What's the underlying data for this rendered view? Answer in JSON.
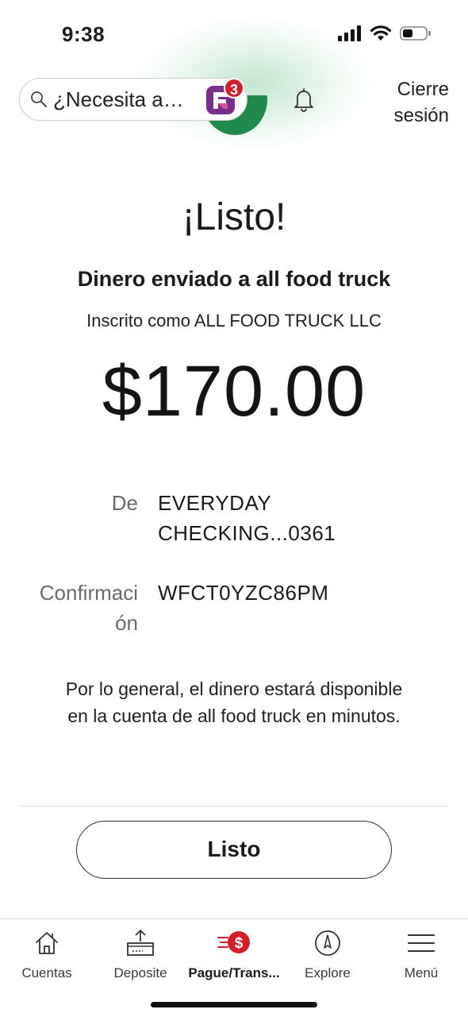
{
  "status_bar": {
    "time": "9:38"
  },
  "header": {
    "search_text": "¿Necesita a…",
    "assistant_badge_count": "3",
    "logout_line1": "Cierre",
    "logout_line2": "sesión"
  },
  "confirmation": {
    "title": "¡Listo!",
    "subtitle": "Dinero enviado a all food truck",
    "enrolled_as": "Inscrito como ALL FOOD TRUCK LLC",
    "amount": "$170.00",
    "from_label": "De",
    "from_value_line1": "EVERYDAY",
    "from_value_line2": "CHECKING...0361",
    "confirmation_label_line1": "Confirmaci",
    "confirmation_label_line2": "ón",
    "confirmation_value": "WFCT0YZC86PM",
    "note": "Por lo general, el dinero estará disponible en la cuenta de all food truck en minutos."
  },
  "done_button": {
    "label": "Listo"
  },
  "nav": {
    "items": [
      {
        "label": "Cuentas",
        "icon": "house-icon"
      },
      {
        "label": "Deposite",
        "icon": "deposit-icon"
      },
      {
        "label": "Pague/Trans...",
        "icon": "pay-transfer-icon",
        "active": true
      },
      {
        "label": "Explore",
        "icon": "compass-icon"
      },
      {
        "label": "Menú",
        "icon": "hamburger-icon"
      }
    ]
  },
  "colors": {
    "accent_red": "#d71e28",
    "brand_green": "#1f8a4c",
    "badge_purple": "#7b2d8e"
  }
}
